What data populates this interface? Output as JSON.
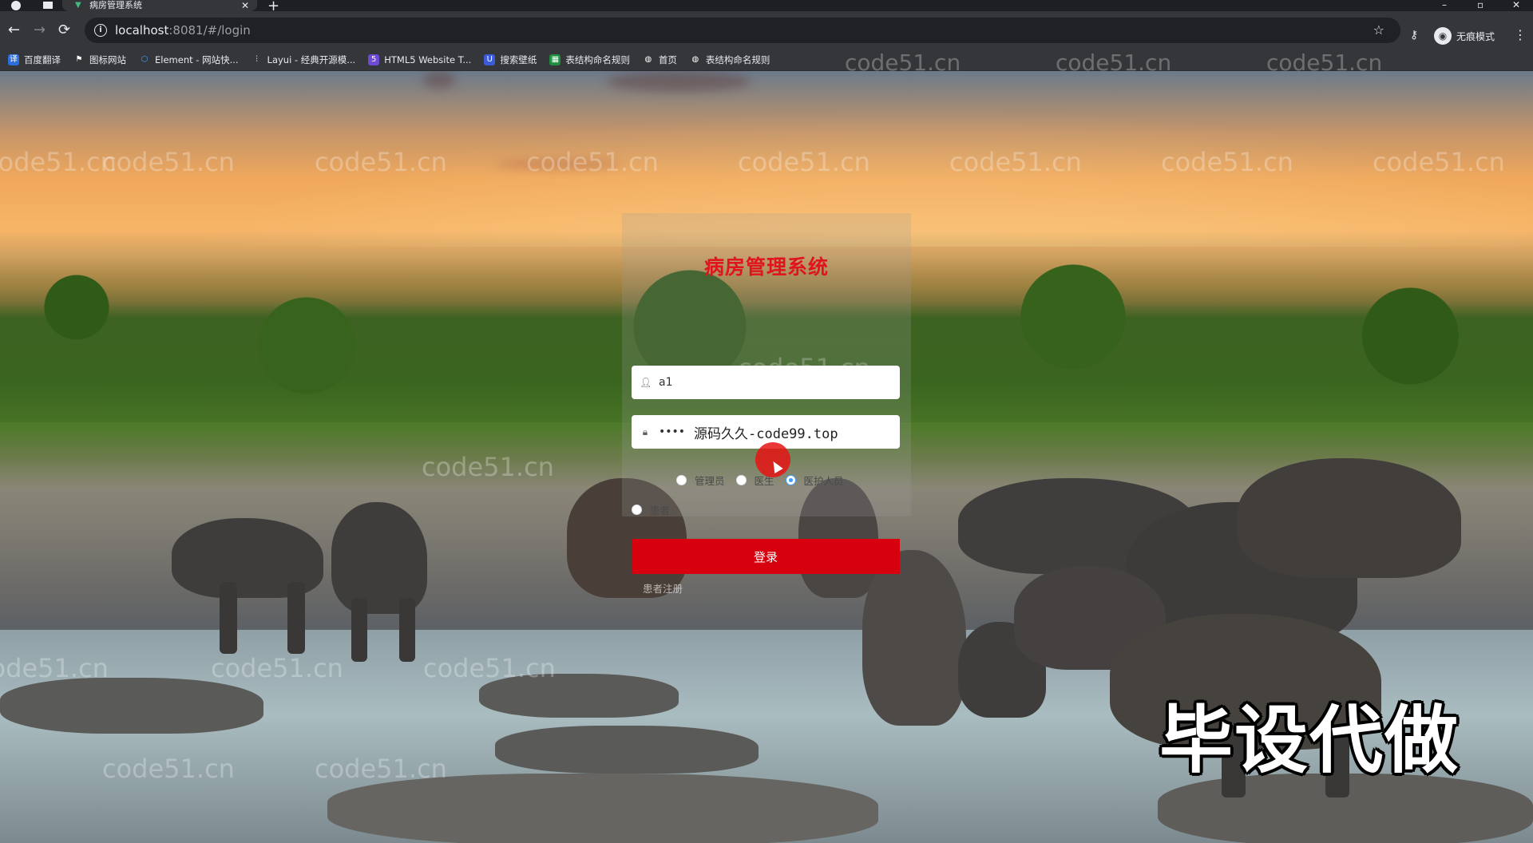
{
  "browser": {
    "tab_title": "病房管理系统",
    "url_host": "localhost",
    "url_rest": ":8081/#/login",
    "incognito_label": "无痕模式",
    "bookmarks": [
      {
        "label": "百度翻译",
        "icon": "translate-icon",
        "color": "#2a6fdb"
      },
      {
        "label": "图标网站",
        "icon": "flag-icon",
        "color": "#5f6368"
      },
      {
        "label": "Element - 网站快...",
        "icon": "element-icon",
        "color": "#409eff"
      },
      {
        "label": "Layui - 经典开源模...",
        "icon": "layui-icon",
        "color": "#5f6368"
      },
      {
        "label": "HTML5 Website T...",
        "icon": "html5-icon",
        "color": "#6c4ad4"
      },
      {
        "label": "搜索壁纸",
        "icon": "wallpaper-icon",
        "color": "#3b5bdb"
      },
      {
        "label": "表结构命名规则",
        "icon": "table-icon",
        "color": "#1e8e3e"
      },
      {
        "label": "首页",
        "icon": "globe-icon",
        "color": "#5f6368"
      },
      {
        "label": "表结构命名规则",
        "icon": "globe-icon",
        "color": "#5f6368"
      }
    ]
  },
  "watermark": "code51.cn",
  "login": {
    "title": "病房管理系统",
    "username_value": "a1",
    "password_value": "••••••",
    "password_overlay": "源码久久-code99.top",
    "roles": [
      {
        "label": "管理员",
        "checked": false
      },
      {
        "label": "医生",
        "checked": false
      },
      {
        "label": "医护人员",
        "checked": true
      },
      {
        "label": "患者",
        "checked": false
      }
    ],
    "submit_label": "登录",
    "register_link": "患者注册"
  },
  "promo_text": "毕设代做"
}
